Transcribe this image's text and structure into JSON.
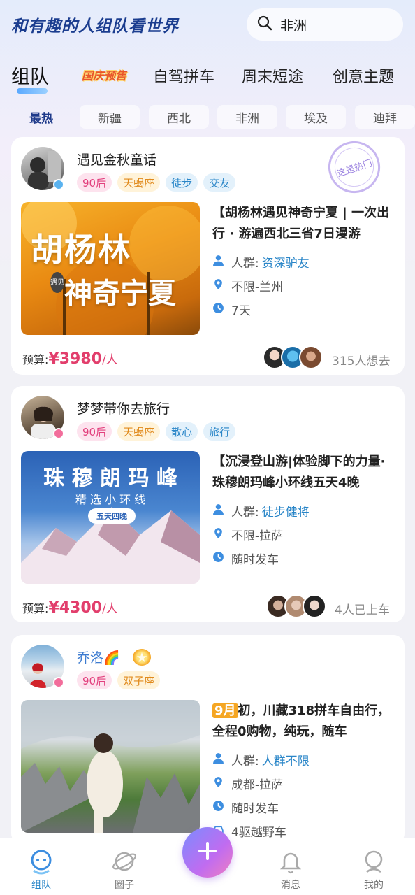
{
  "header": {
    "slogan": "和有趣的人组队看世界",
    "search_value": "非洲"
  },
  "tabs": [
    {
      "label": "组队",
      "active": true
    },
    {
      "label": "国庆预售",
      "promo": true
    },
    {
      "label": "自驾拼车"
    },
    {
      "label": "周末短途"
    },
    {
      "label": "创意主题"
    }
  ],
  "chips": [
    "最热",
    "新疆",
    "西北",
    "非洲",
    "埃及",
    "迪拜"
  ],
  "active_chip": "最热",
  "cards": [
    {
      "user": "遇见金秋童话",
      "tags": [
        "90后",
        "天蝎座",
        "徒步",
        "交友"
      ],
      "stamp": "这是热门",
      "cover_text_1": "胡杨林",
      "cover_text_2": "神奇宁夏",
      "cover_text_3": "遇见",
      "title": "【胡杨林遇见神奇宁夏 | 一次出行 · 游遍西北三省7日漫游",
      "crowd_label": "人群:",
      "crowd_value": "资深驴友",
      "location": "不限-兰州",
      "duration": "7天",
      "budget_label": "预算:",
      "budget_value": "¥3980",
      "budget_unit": "/人",
      "joined": "315人想去"
    },
    {
      "user": "梦梦带你去旅行",
      "tags": [
        "90后",
        "天蝎座",
        "散心",
        "旅行"
      ],
      "cover_text_1": "珠 穆 朗 玛 峰",
      "cover_text_2": "精 选 小 环 线",
      "cover_text_3": "五天四晚",
      "title": "【沉浸登山游|体验脚下的力量·珠穆朗玛峰小环线五天4晚",
      "crowd_label": "人群:",
      "crowd_value": "徒步健将",
      "location": "不限-拉萨",
      "duration": "随时发车",
      "budget_label": "预算:",
      "budget_value": "¥4300",
      "budget_unit": "/人",
      "joined": "4人已上车"
    },
    {
      "user": "乔洛🌈",
      "tags": [
        "90后",
        "双子座"
      ],
      "title_month": "9月",
      "title": "初，川藏318拼车自由行，全程0购物，纯玩，随车",
      "crowd_label": "人群:",
      "crowd_value": "人群不限",
      "location": "成都-拉萨",
      "duration": "随时发车",
      "vehicle": "4驱越野车"
    }
  ],
  "bottom_nav": [
    {
      "label": "组队",
      "active": true
    },
    {
      "label": "圈子"
    },
    {
      "label": "消息"
    },
    {
      "label": "我的"
    }
  ],
  "colors": {
    "accent": "#2a86c8",
    "price": "#e23e6c",
    "brand_dark": "#1b3d8f"
  }
}
